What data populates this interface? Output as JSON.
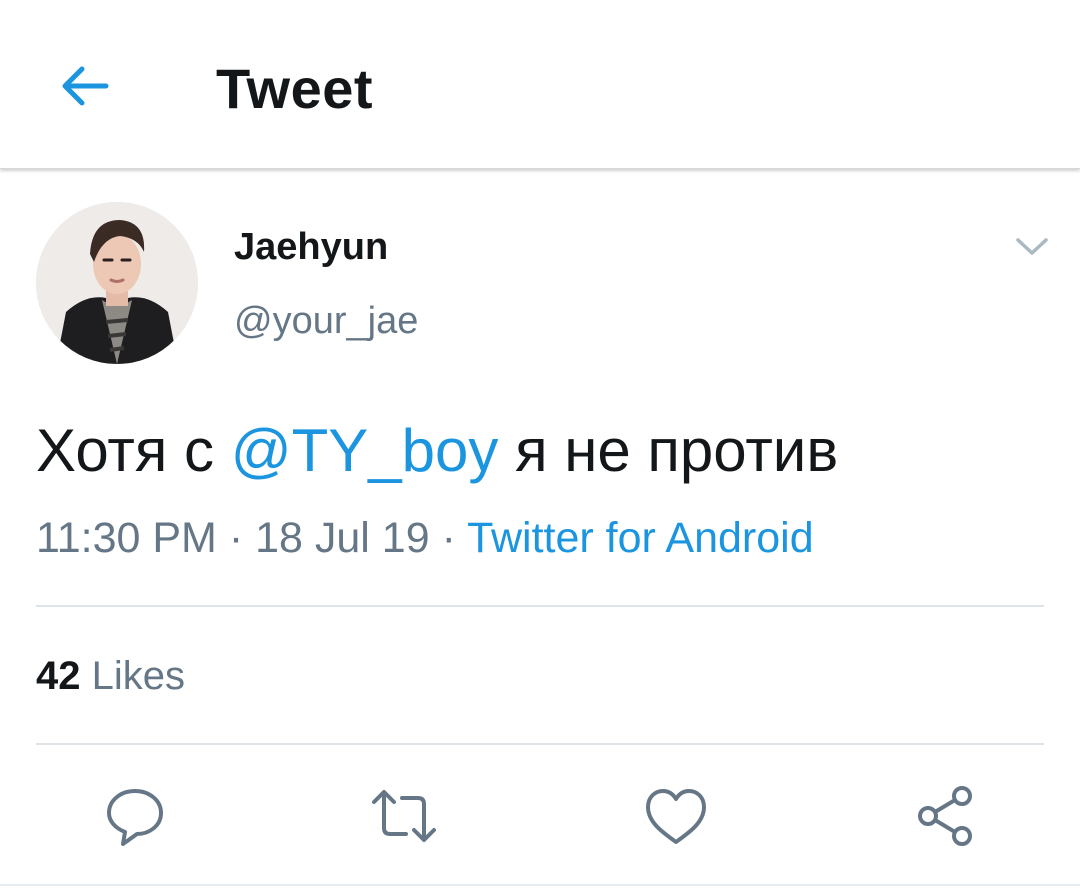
{
  "header": {
    "title": "Tweet",
    "back_icon": "arrow-left-icon",
    "accent_color": "#1b95e0"
  },
  "tweet": {
    "author": {
      "name": "Jaehyun",
      "handle": "@your_jae"
    },
    "text": {
      "before": "Хотя с ",
      "mention": "@TY_boy",
      "after": " я не против"
    },
    "time": "11:30 PM",
    "separator": " · ",
    "date": "18 Jul 19",
    "source": "Twitter for Android",
    "likes": {
      "count": "42",
      "label": "Likes"
    }
  },
  "actions": [
    {
      "icon": "reply-icon"
    },
    {
      "icon": "retweet-icon"
    },
    {
      "icon": "like-icon"
    },
    {
      "icon": "share-icon"
    }
  ],
  "colors": {
    "text_primary": "#14171a",
    "text_secondary": "#657786",
    "link": "#1b95e0",
    "divider": "#dfe4e8"
  }
}
